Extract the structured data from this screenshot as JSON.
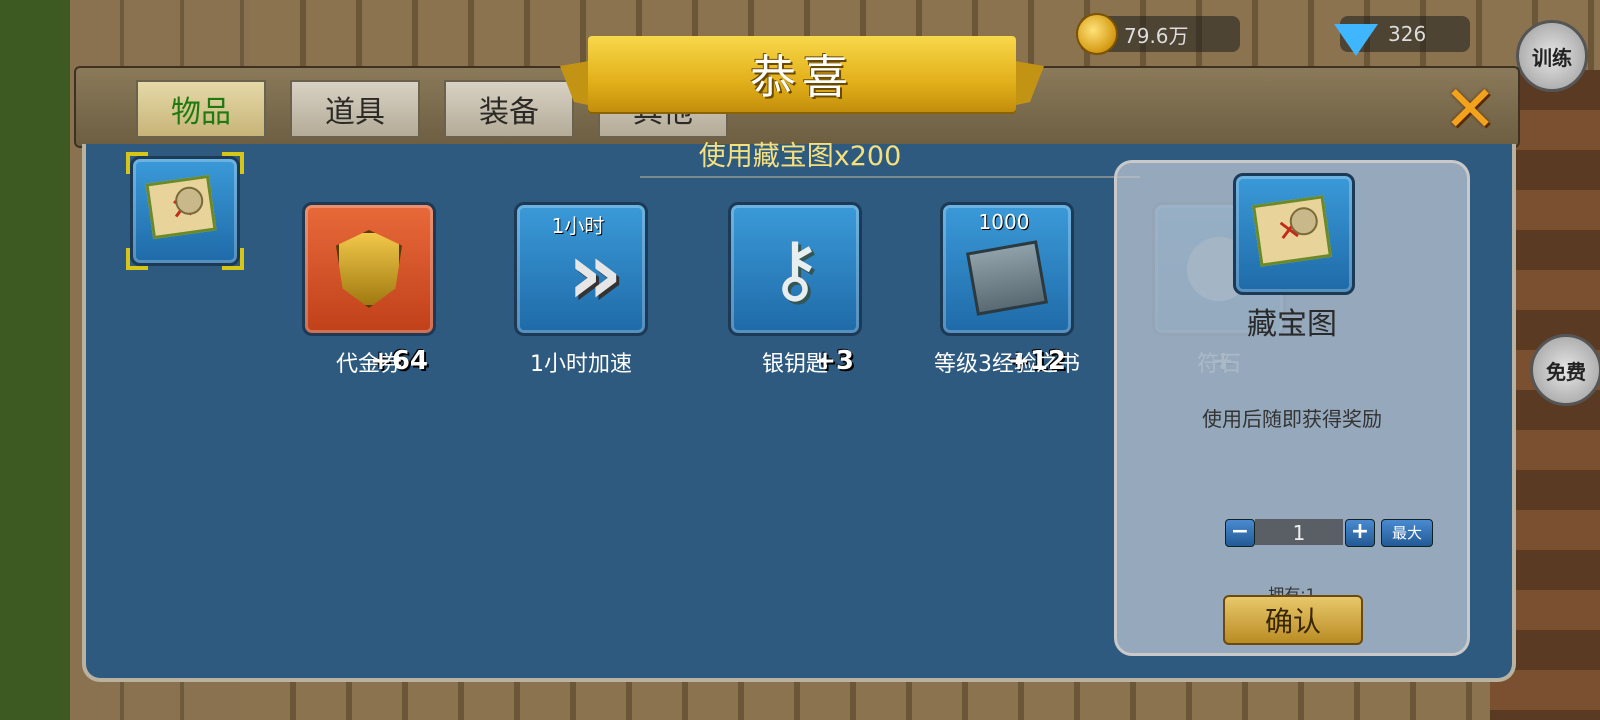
{
  "hud": {
    "gold": "79.6万",
    "gems": "326",
    "train_label": "训练",
    "free_label": "免费"
  },
  "tabs": [
    {
      "label": "物品",
      "active": true
    },
    {
      "label": "道具",
      "active": false
    },
    {
      "label": "装备",
      "active": false
    },
    {
      "label": "其他",
      "active": false
    }
  ],
  "popup": {
    "title": "恭喜",
    "subtitle": "使用藏宝图x200",
    "selected_item_icon": "treasure-map-icon"
  },
  "rewards": [
    {
      "name": "代金券",
      "count": "+64",
      "badge": "",
      "icon": "voucher-shield-icon"
    },
    {
      "name": "1小时加速",
      "count": "",
      "badge": "1小时",
      "icon": "speedup-chevron-icon"
    },
    {
      "name": "银钥匙",
      "count": "+3",
      "badge": "",
      "icon": "silver-key-icon"
    },
    {
      "name": "等级3经验之书",
      "count": "+12",
      "badge": "1000",
      "icon": "exp-book-icon"
    },
    {
      "name": "符石",
      "count": "+",
      "badge": "",
      "icon": "rune-stone-icon"
    }
  ],
  "detail": {
    "name": "藏宝图",
    "description": "使用后随即获得奖励",
    "quantity": "1",
    "minus": "−",
    "plus": "+",
    "max_label": "最大",
    "owned": "拥有:1",
    "confirm_label": "确认"
  },
  "colors": {
    "panel": "#2f5a80",
    "banner": "#e2b01a",
    "active_tab_text": "#1f7a10",
    "subtitle": "#f5e07c"
  }
}
